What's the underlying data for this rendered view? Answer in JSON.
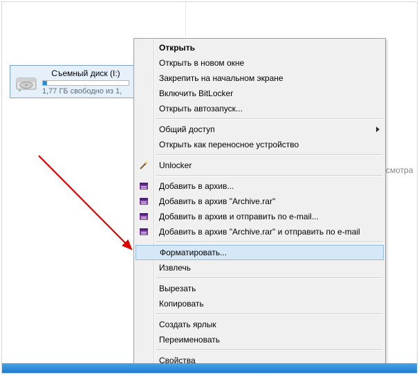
{
  "drive": {
    "label": "Съемный диск (I:)",
    "subtext": "1,77 ГБ свободно из 1,",
    "fill_percent": 5
  },
  "ambient_text": "смотра",
  "menu": {
    "items": [
      {
        "label": "Открыть",
        "bold": true
      },
      {
        "label": "Открыть в новом окне"
      },
      {
        "label": "Закрепить на начальном экране"
      },
      {
        "label": "Включить BitLocker"
      },
      {
        "label": "Открыть автозапуск..."
      }
    ],
    "group2": [
      {
        "label": "Общий доступ",
        "submenu": true
      },
      {
        "label": "Открыть как переносное устройство"
      }
    ],
    "group3": [
      {
        "label": "Unlocker",
        "icon": "wand"
      }
    ],
    "group4": [
      {
        "label": "Добавить в архив...",
        "icon": "rar"
      },
      {
        "label": "Добавить в архив \"Archive.rar\"",
        "icon": "rar"
      },
      {
        "label": "Добавить в архив и отправить по e-mail...",
        "icon": "rar"
      },
      {
        "label": "Добавить в архив \"Archive.rar\" и отправить по e-mail",
        "icon": "rar"
      }
    ],
    "group5": [
      {
        "label": "Форматировать...",
        "highlight": true
      },
      {
        "label": "Извлечь"
      }
    ],
    "group6": [
      {
        "label": "Вырезать"
      },
      {
        "label": "Копировать"
      }
    ],
    "group7": [
      {
        "label": "Создать ярлык"
      },
      {
        "label": "Переименовать"
      }
    ],
    "group8": [
      {
        "label": "Свойства"
      }
    ]
  }
}
